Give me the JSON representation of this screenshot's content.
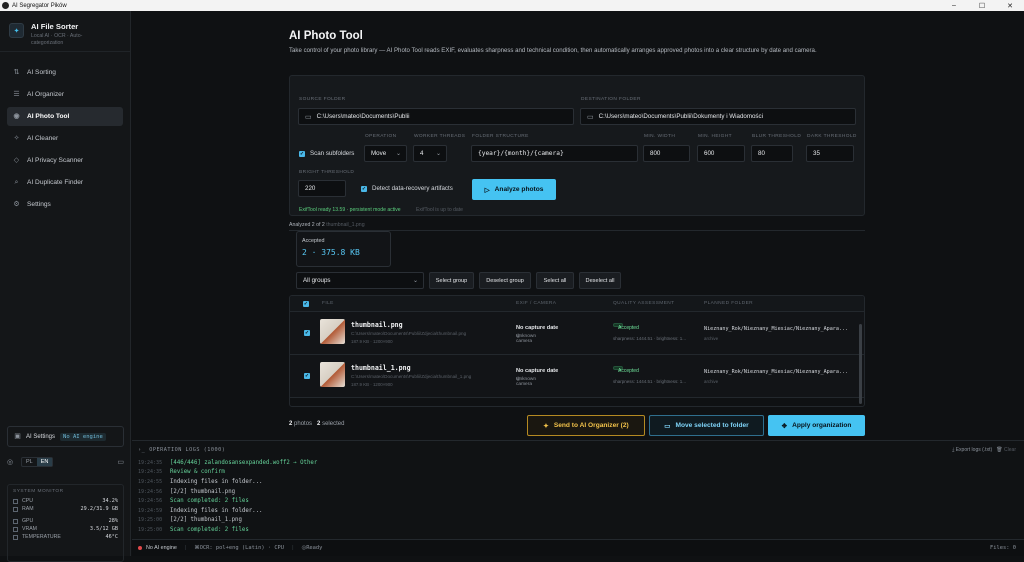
{
  "window": {
    "title": "AI Segregator Pików",
    "controls": [
      "–",
      "☐",
      "✕"
    ]
  },
  "brand": {
    "title": "AI File Sorter",
    "subtitle": "Local AI · OCR · Auto-categorization"
  },
  "nav": [
    {
      "label": "AI Sorting",
      "icon": "sort-icon"
    },
    {
      "label": "AI Organizer",
      "icon": "organizer-icon"
    },
    {
      "label": "AI Photo Tool",
      "icon": "camera-icon",
      "active": true
    },
    {
      "label": "AI Cleaner",
      "icon": "cleaner-icon"
    },
    {
      "label": "AI Privacy Scanner",
      "icon": "shield-icon"
    },
    {
      "label": "AI Duplicate Finder",
      "icon": "search-icon"
    },
    {
      "label": "Settings",
      "icon": "gear-icon"
    }
  ],
  "ai_settings": {
    "label": "AI Settings",
    "engine": "No AI engine"
  },
  "lang": {
    "options": [
      "PL",
      "EN"
    ],
    "selected": "EN"
  },
  "sysmon": {
    "title": "SYSTEM MONITOR",
    "rows": [
      {
        "label": "CPU",
        "value": "34.2%"
      },
      {
        "label": "RAM",
        "value": "29.2/31.9 GB"
      },
      {
        "label": "GPU",
        "value": "28%"
      },
      {
        "label": "VRAM",
        "value": "3.5/12 GB"
      },
      {
        "label": "TEMPERATURE",
        "value": "46°C"
      }
    ]
  },
  "page": {
    "title": "AI Photo Tool",
    "description": "Take control of your photo library — AI Photo Tool reads EXIF, evaluates sharpness and technical condition, then automatically arranges approved photos into a clear structure by date and camera."
  },
  "form": {
    "source_label": "SOURCE FOLDER",
    "source_value": "C:\\Users\\mateo\\Documents\\Publii",
    "dest_label": "DESTINATION FOLDER",
    "dest_value": "C:\\Users\\mateo\\Documents\\Publii\\Dokumenty i Wiadomości",
    "scan_subfolders": "Scan subfolders",
    "operation_label": "OPERATION",
    "operation_value": "Move",
    "threads_label": "WORKER THREADS",
    "threads_value": "4",
    "structure_label": "FOLDER STRUCTURE",
    "structure_value": "{year}/{month}/{camera}",
    "minwidth_label": "MIN. WIDTH",
    "minwidth_value": "800",
    "minheight_label": "MIN. HEIGHT",
    "minheight_value": "600",
    "blur_label": "BLUR THRESHOLD",
    "blur_value": "80",
    "dark_label": "DARK THRESHOLD",
    "dark_value": "35",
    "bright_label": "BRIGHT THRESHOLD",
    "bright_value": "220",
    "detect_label": "Detect data-recovery artifacts",
    "analyze_label": "Analyze photos",
    "status_ok": "ExifTool ready 13.59 · persistent mode active",
    "status_muted": "ExifTool is up to date"
  },
  "results": {
    "analyzed": "Analyzed 2 of 2",
    "analyzed_file": "thumbnail_1.png",
    "accepted_title": "Accepted",
    "accepted_value": "2 · 375.8 KB",
    "group_select": "All groups",
    "buttons": [
      "Select group",
      "Deselect group",
      "Select all",
      "Deselect all"
    ]
  },
  "table": {
    "headers": {
      "file": "FILE",
      "exif": "EXIF / CAMERA",
      "quality": "QUALITY ASSESSMENT",
      "folder": "PLANNED FOLDER"
    },
    "rows": [
      {
        "name": "thumbnail.png",
        "path": "C:\\Users\\mateo\\Documents\\Publii\\Zdjecia\\thumbnail.png",
        "meta": "187.9 KB · 1200×900",
        "exif": "No capture date",
        "camera": "Unknown camera",
        "status": "Accepted",
        "quality": "sharpness: 1444.51 · brightness: 1...",
        "folder": "Nieznany_Rok/Nieznany_Miesiac/Nieznany_Apara...",
        "folder_sub": "archive"
      },
      {
        "name": "thumbnail_1.png",
        "path": "C:\\Users\\mateo\\Documents\\Publii\\Zdjecia\\thumbnail_1.png",
        "meta": "187.9 KB · 1200×900",
        "exif": "No capture date",
        "camera": "Unknown camera",
        "status": "Accepted",
        "quality": "sharpness: 1444.51 · brightness: 1...",
        "folder": "Nieznany_Rok/Nieznany_Miesiac/Nieznany_Apara...",
        "folder_sub": "archive"
      }
    ]
  },
  "footer": {
    "photos_count": "2",
    "photos_label": "photos",
    "selected_count": "2",
    "selected_label": "selected",
    "send_btn": "Send to AI Organizer (2)",
    "move_btn": "Move selected to folder",
    "apply_btn": "Apply organization"
  },
  "logs": {
    "title": "OPERATION LOGS",
    "count": "(1000)",
    "export": "Export logs (.txt)",
    "clear": "Clear",
    "lines": [
      {
        "ts": "19:24:35",
        "text": "[446/446] zalandosansexpanded.woff2 → Other",
        "green": true
      },
      {
        "ts": "19:24:35",
        "text": "Review & confirm",
        "green": true
      },
      {
        "ts": "19:24:55",
        "text": "Indexing files in folder...",
        "green": false
      },
      {
        "ts": "19:24:56",
        "text": "[2/2] thumbnail.png",
        "green": false
      },
      {
        "ts": "19:24:56",
        "text": "Scan completed: 2 files",
        "green": true
      },
      {
        "ts": "19:24:59",
        "text": "Indexing files in folder...",
        "green": false
      },
      {
        "ts": "19:25:00",
        "text": "[2/2] thumbnail_1.png",
        "green": false
      },
      {
        "ts": "19:25:00",
        "text": "Scan completed: 2 files",
        "green": true
      }
    ]
  },
  "statusbar": {
    "engine": "No AI engine",
    "ocr": "OCR: pol+eng (Latin) · CPU",
    "ready": "Ready",
    "files": "Files: 0"
  },
  "colors": {
    "accent": "#45c3f2",
    "amber": "#f3c34a",
    "success": "#5cd27f"
  }
}
